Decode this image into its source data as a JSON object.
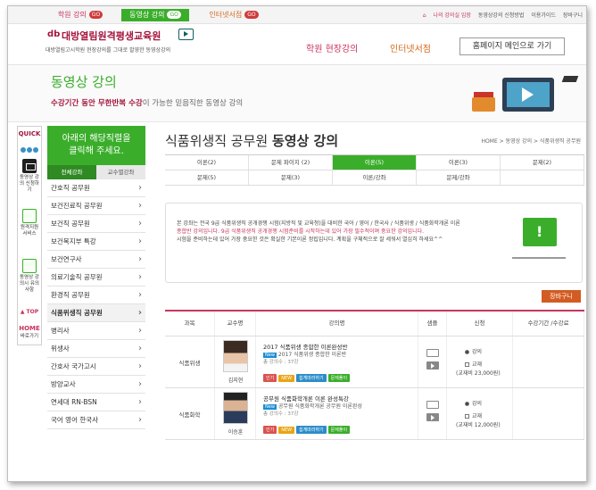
{
  "topbar": {
    "tab1": "학원 강의",
    "tab2": "동영상 강의",
    "tab3": "인터넷서점",
    "go": "GO",
    "links": [
      "나의 강의실 입장",
      "동영상강의 신청방법",
      "이용가이드",
      "장바구니"
    ]
  },
  "header": {
    "logo": "대방열림원격평생교육원",
    "logo_sub": "대방열림고시학원 현장강의를 그대로 촬영한 동영상강의",
    "nav": [
      "학원 현장강의",
      "인터넷서점"
    ],
    "home_button": "홈페이지 메인으로 가기"
  },
  "banner": {
    "title": "동영상 강의",
    "sub_strong": "수강기간 동안 무한반복 수강",
    "sub_rest": "이 가능한 믿음직한 동영상 강의"
  },
  "quick": {
    "title": "QUICK",
    "items": [
      "동영상 강의 신청하기",
      "원격지원 서비스",
      "동영상 강의시 유의사항"
    ],
    "top": "▲ TOP",
    "home": "HOME",
    "home_sub": "바로가기"
  },
  "sidebar": {
    "head_line1": "아래의 해당직렬을",
    "head_line2": "클릭해 주세요.",
    "tabs": [
      "전체강좌",
      "교수별강좌"
    ],
    "items": [
      "간호직 공무원",
      "보건진료직 공무원",
      "보건직 공무원",
      "보건복지부 특강",
      "보건연구사",
      "의료기술직 공무원",
      "환경직 공무원",
      "식품위생직 공무원",
      "병리사",
      "위생사",
      "간호사 국가고시",
      "방양교사",
      "연세대 RN-BSN",
      "국어 영어 한국사"
    ]
  },
  "main": {
    "title_light": "식품위생직 공무원 ",
    "title_bold": "동영상 강의",
    "breadcrumb": "HOME > 동영상 강의 > 식품위생직 공무원",
    "tabs_row1": [
      "이론(2)",
      "문제 파이지 (2)",
      "이론(5)",
      "이론(3)",
      "문제(2)"
    ],
    "tabs_row2": [
      "문제(5)",
      "문제(3)",
      "이론/강좌",
      "문제/강좌"
    ],
    "selected_tab": "이론(5)",
    "notice_lines": [
      "본 강좌는 전국 9급 식품위생직 공개경쟁 시험(지방직 및 교육청)을 대비한 국어 / 영어 / 한국사 / 식품위생 / 식품화학개론 이론",
      "종합반 강의입니다. 9급 식품위생직 공개경쟁 시험준비를 시작하는데 있어 가장 필수적이며 중요한 강의입니다.",
      "시험을 준비하는데 있어 가장 중요한 것은 확실한 기본이론 정립입니다. 계획을 구체적으로 잘 세워서 열심히 하세요^^"
    ],
    "cart_button": "장바구니"
  },
  "table": {
    "headers": [
      "과목",
      "교수명",
      "강의명",
      "샘플",
      "신청",
      "수강기간 /수강료"
    ],
    "rows": [
      {
        "subject": "식품위생",
        "professor": "김지현",
        "title": "2017 식품위생 종합한 이론완성반",
        "sub_tag": "New",
        "sub": "2017 식품위생 종합한 이론반",
        "count": "총 강의수 : 37강",
        "badges": [
          "인기",
          "NEW",
          "쉽게따라하기",
          "문제풀이"
        ],
        "opt1": "강의",
        "opt2": "교재",
        "price": "(교재비 23,000원)"
      },
      {
        "subject": "식품화학",
        "professor": "이승훈",
        "title": "공무원 식품화학개론 이론 완성특강",
        "sub_tag": "New",
        "sub": "공무원 식품화학개론 공무원 이론완성",
        "count": "총 강의수 : 37강",
        "badges": [
          "인기",
          "NEW",
          "쉽게따라하기",
          "문제풀이"
        ],
        "opt1": "강의",
        "opt2": "교재",
        "price": "(교재비 12,000원)"
      }
    ]
  }
}
